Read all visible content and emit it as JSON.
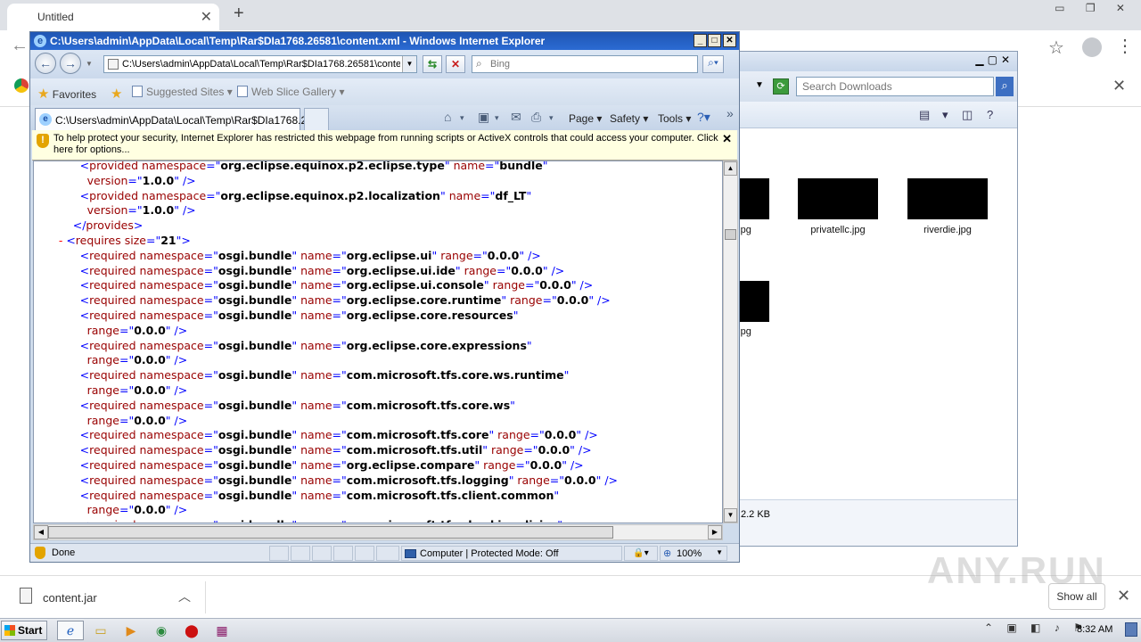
{
  "chrome": {
    "tab_title": "Untitled",
    "download": {
      "file_name": "content.jar",
      "show_all": "Show all"
    },
    "watermark": "ANY.RUN"
  },
  "explorer": {
    "search_placeholder": "Search Downloads",
    "thumbnails": [
      {
        "label": ".jpg"
      },
      {
        "label": "privatellc.jpg"
      },
      {
        "label": "riverdie.jpg"
      },
      {
        "label": ".jpg"
      }
    ],
    "status_size": "2.2 KB"
  },
  "ie": {
    "window_title": "C:\\Users\\admin\\AppData\\Local\\Temp\\Rar$DIa1768.26581\\content.xml - Windows Internet Explorer",
    "address": "C:\\Users\\admin\\AppData\\Local\\Temp\\Rar$DIa1768.26581\\content.xml",
    "search_placeholder": "Bing",
    "favorites": {
      "favorites_label": "Favorites",
      "suggested_sites": "Suggested Sites",
      "web_slice_gallery": "Web Slice Gallery"
    },
    "tab_title": "C:\\Users\\admin\\AppData\\Local\\Temp\\Rar$DIa1768.2...",
    "command_bar": {
      "page": "Page",
      "safety": "Safety",
      "tools": "Tools"
    },
    "infobar_message": "To help protect your security, Internet Explorer has restricted this webpage from running scripts or ActiveX controls that could access your computer. Click here for options...",
    "status": {
      "done": "Done",
      "zone": "Computer | Protected Mode: Off",
      "zoom": "100%"
    },
    "xml_lines": [
      {
        "indent": "    ",
        "kind": "el",
        "tag": "provided",
        "attrs": [
          [
            "namespace",
            "org.eclipse.equinox.p2.eclipse.type"
          ],
          [
            "name",
            "bundle"
          ]
        ],
        "close": ""
      },
      {
        "indent": "      ",
        "kind": "cont",
        "attrs": [
          [
            "version",
            "1.0.0"
          ]
        ],
        "close": " />"
      },
      {
        "indent": "    ",
        "kind": "el",
        "tag": "provided",
        "attrs": [
          [
            "namespace",
            "org.eclipse.equinox.p2.localization"
          ],
          [
            "name",
            "df_LT"
          ]
        ],
        "close": ""
      },
      {
        "indent": "      ",
        "kind": "cont",
        "attrs": [
          [
            "version",
            "1.0.0"
          ]
        ],
        "close": " />"
      },
      {
        "indent": "  ",
        "kind": "end",
        "tag": "provides"
      },
      {
        "indent": "",
        "kind": "open",
        "tag": "requires",
        "attrs": [
          [
            "size",
            "21"
          ]
        ],
        "close": ">"
      },
      {
        "indent": "    ",
        "kind": "el",
        "tag": "required",
        "attrs": [
          [
            "namespace",
            "osgi.bundle"
          ],
          [
            "name",
            "org.eclipse.ui"
          ],
          [
            "range",
            "0.0.0"
          ]
        ],
        "close": " />"
      },
      {
        "indent": "    ",
        "kind": "el",
        "tag": "required",
        "attrs": [
          [
            "namespace",
            "osgi.bundle"
          ],
          [
            "name",
            "org.eclipse.ui.ide"
          ],
          [
            "range",
            "0.0.0"
          ]
        ],
        "close": " />"
      },
      {
        "indent": "    ",
        "kind": "el",
        "tag": "required",
        "attrs": [
          [
            "namespace",
            "osgi.bundle"
          ],
          [
            "name",
            "org.eclipse.ui.console"
          ],
          [
            "range",
            "0.0.0"
          ]
        ],
        "close": " />"
      },
      {
        "indent": "    ",
        "kind": "el",
        "tag": "required",
        "attrs": [
          [
            "namespace",
            "osgi.bundle"
          ],
          [
            "name",
            "org.eclipse.core.runtime"
          ],
          [
            "range",
            "0.0.0"
          ]
        ],
        "close": " />"
      },
      {
        "indent": "    ",
        "kind": "el",
        "tag": "required",
        "attrs": [
          [
            "namespace",
            "osgi.bundle"
          ],
          [
            "name",
            "org.eclipse.core.resources"
          ]
        ],
        "close": ""
      },
      {
        "indent": "      ",
        "kind": "cont",
        "attrs": [
          [
            "range",
            "0.0.0"
          ]
        ],
        "close": " />"
      },
      {
        "indent": "    ",
        "kind": "el",
        "tag": "required",
        "attrs": [
          [
            "namespace",
            "osgi.bundle"
          ],
          [
            "name",
            "org.eclipse.core.expressions"
          ]
        ],
        "close": ""
      },
      {
        "indent": "      ",
        "kind": "cont",
        "attrs": [
          [
            "range",
            "0.0.0"
          ]
        ],
        "close": " />"
      },
      {
        "indent": "    ",
        "kind": "el",
        "tag": "required",
        "attrs": [
          [
            "namespace",
            "osgi.bundle"
          ],
          [
            "name",
            "com.microsoft.tfs.core.ws.runtime"
          ]
        ],
        "close": ""
      },
      {
        "indent": "      ",
        "kind": "cont",
        "attrs": [
          [
            "range",
            "0.0.0"
          ]
        ],
        "close": " />"
      },
      {
        "indent": "    ",
        "kind": "el",
        "tag": "required",
        "attrs": [
          [
            "namespace",
            "osgi.bundle"
          ],
          [
            "name",
            "com.microsoft.tfs.core.ws"
          ]
        ],
        "close": ""
      },
      {
        "indent": "      ",
        "kind": "cont",
        "attrs": [
          [
            "range",
            "0.0.0"
          ]
        ],
        "close": " />"
      },
      {
        "indent": "    ",
        "kind": "el",
        "tag": "required",
        "attrs": [
          [
            "namespace",
            "osgi.bundle"
          ],
          [
            "name",
            "com.microsoft.tfs.core"
          ],
          [
            "range",
            "0.0.0"
          ]
        ],
        "close": " />"
      },
      {
        "indent": "    ",
        "kind": "el",
        "tag": "required",
        "attrs": [
          [
            "namespace",
            "osgi.bundle"
          ],
          [
            "name",
            "com.microsoft.tfs.util"
          ],
          [
            "range",
            "0.0.0"
          ]
        ],
        "close": " />"
      },
      {
        "indent": "    ",
        "kind": "el",
        "tag": "required",
        "attrs": [
          [
            "namespace",
            "osgi.bundle"
          ],
          [
            "name",
            "org.eclipse.compare"
          ],
          [
            "range",
            "0.0.0"
          ]
        ],
        "close": " />"
      },
      {
        "indent": "    ",
        "kind": "el",
        "tag": "required",
        "attrs": [
          [
            "namespace",
            "osgi.bundle"
          ],
          [
            "name",
            "com.microsoft.tfs.logging"
          ],
          [
            "range",
            "0.0.0"
          ]
        ],
        "close": " />"
      },
      {
        "indent": "    ",
        "kind": "el",
        "tag": "required",
        "attrs": [
          [
            "namespace",
            "osgi.bundle"
          ],
          [
            "name",
            "com.microsoft.tfs.client.common"
          ]
        ],
        "close": ""
      },
      {
        "indent": "      ",
        "kind": "cont",
        "attrs": [
          [
            "range",
            "0.0.0"
          ]
        ],
        "close": " />"
      },
      {
        "indent": "    ",
        "kind": "el",
        "tag": "required",
        "attrs": [
          [
            "namespace",
            "osgi.bundle"
          ],
          [
            "name",
            "com.microsoft.tfs.checkinpolicies"
          ]
        ],
        "close": ""
      }
    ]
  },
  "taskbar": {
    "start_label": "Start",
    "clock": "8:32 AM"
  }
}
